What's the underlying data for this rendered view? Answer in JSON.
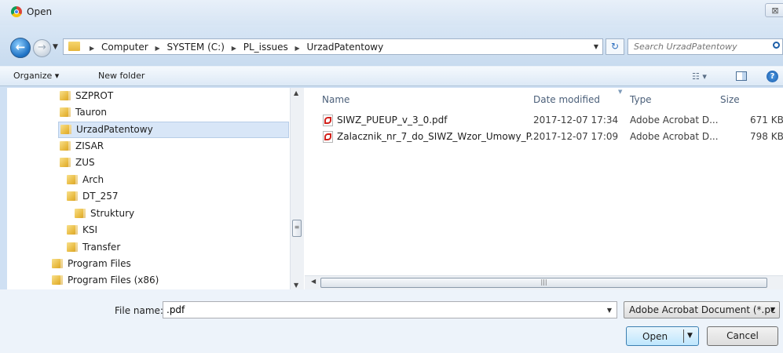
{
  "window": {
    "title": "Open",
    "close_glyph": "⊠"
  },
  "icons": {
    "app": "chrome-icon",
    "back": "back-arrow-icon",
    "forward": "forward-arrow-icon",
    "refresh": "refresh-icon",
    "search": "search-icon",
    "pdf": "pdf-file-icon",
    "folder": "folder-icon"
  },
  "nav": {
    "back_glyph": "←",
    "forward_glyph": "→",
    "refresh_glyph": "↻",
    "breadcrumb": [
      "Computer",
      "SYSTEM (C:)",
      "PL_issues",
      "UrzadPatentowy"
    ],
    "search_placeholder": "Search UrzadPatentowy"
  },
  "toolbar": {
    "organize": "Organize ▾",
    "new_folder": "New folder",
    "help": "?"
  },
  "tree": [
    {
      "label": "SZPROT",
      "selected": false
    },
    {
      "label": "Tauron",
      "selected": false
    },
    {
      "label": "UrzadPatentowy",
      "selected": true
    },
    {
      "label": "ZISAR",
      "selected": false
    },
    {
      "label": "ZUS",
      "selected": false
    },
    {
      "label": "Arch",
      "selected": false
    },
    {
      "label": "DT_257",
      "selected": false
    },
    {
      "label": "Struktury",
      "selected": false
    },
    {
      "label": "KSI",
      "selected": false
    },
    {
      "label": "Transfer",
      "selected": false
    },
    {
      "label": "Program Files",
      "selected": false
    },
    {
      "label": "Program Files (x86)",
      "selected": false
    }
  ],
  "columns": {
    "name": "Name",
    "date": "Date modified",
    "type": "Type",
    "size": "Size"
  },
  "files": [
    {
      "name": "SIWZ_PUEUP_v_3_0.pdf",
      "date": "2017-12-07 17:34",
      "type": "Adobe Acrobat D...",
      "size": "671 KB"
    },
    {
      "name": "Zalacznik_nr_7_do_SIWZ_Wzor_Umowy_P...",
      "date": "2017-12-07 17:09",
      "type": "Adobe Acrobat D...",
      "size": "798 KB"
    }
  ],
  "scroll": {
    "grip": "≡",
    "h_grip": "|||"
  },
  "footer": {
    "file_name_label": "File name:",
    "file_name_value": ".pdf",
    "file_type": "Adobe Acrobat Document (*.pc",
    "open": "Open",
    "cancel": "Cancel"
  }
}
